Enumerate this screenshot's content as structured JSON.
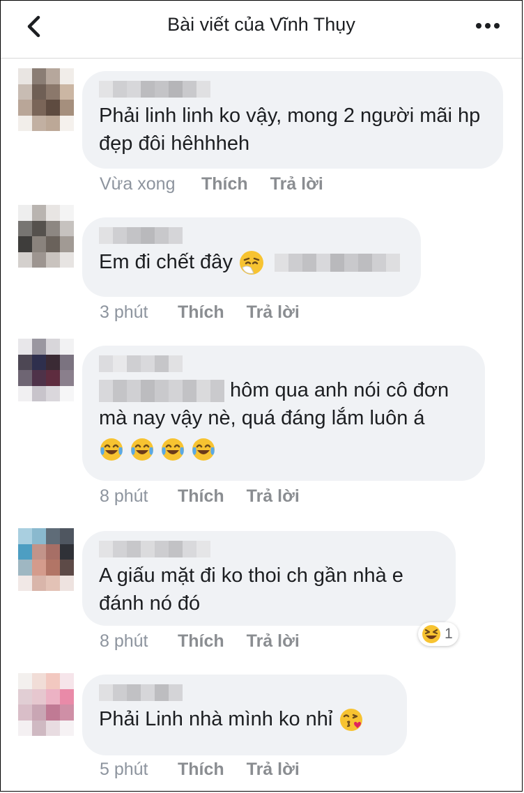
{
  "header": {
    "title": "Bài viết của Vĩnh Thụy"
  },
  "icons": {
    "back": "chevron-left-icon",
    "more": "more-dots-icon"
  },
  "actions": {
    "like": "Thích",
    "reply": "Trả lời"
  },
  "comments": [
    {
      "text": "Phải linh linh ko vậy, mong 2 người mãi hp đẹp đôi hêhhheh",
      "time": "Vừa xong"
    },
    {
      "text": "Em đi chết đây",
      "emoji": "sneezing-face-emoji",
      "time": "3 phút"
    },
    {
      "text": "hôm qua anh nói cô đơn mà nay vậy nè, quá đáng lắm luôn á",
      "emoji": "tears-of-joy-emoji",
      "time": "8 phút"
    },
    {
      "text": "A giấu mặt đi ko thoi ch gần nhà e đánh nó đó",
      "time": "8 phút",
      "reaction": {
        "emoji": "laughing-emoji",
        "count": "1"
      }
    },
    {
      "text": "Phải Linh nhà mình ko nhỉ",
      "emoji": "kissing-heart-emoji",
      "time": "5 phút"
    }
  ]
}
